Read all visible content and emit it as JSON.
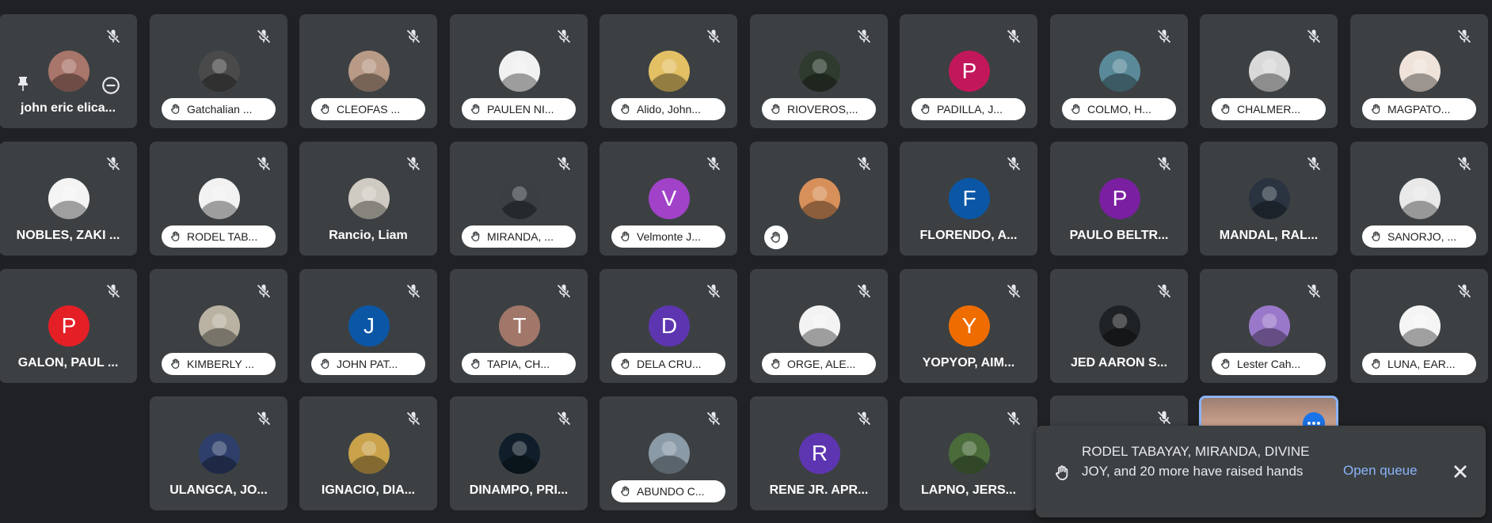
{
  "tiles": [
    {
      "name": "john eric elica...",
      "style": "plain",
      "avatar": {
        "type": "photo",
        "bg": "#a9766b"
      },
      "pin": true
    },
    {
      "name": "Gatchalian ...",
      "style": "pill",
      "avatar": {
        "type": "photo",
        "bg": "#4a4a4a"
      }
    },
    {
      "name": "CLEOFAS ...",
      "style": "pill",
      "avatar": {
        "type": "photo",
        "bg": "#b89a86"
      }
    },
    {
      "name": "PAULEN NI...",
      "style": "pill",
      "avatar": {
        "type": "photo",
        "bg": "#f1f1f1"
      }
    },
    {
      "name": "Alido, John...",
      "style": "pill",
      "avatar": {
        "type": "photo",
        "bg": "#e3c064"
      }
    },
    {
      "name": "RIOVEROS,...",
      "style": "pill",
      "avatar": {
        "type": "photo",
        "bg": "#2e3b2e"
      }
    },
    {
      "name": "PADILLA, J...",
      "style": "pill",
      "avatar": {
        "type": "letter",
        "letter": "P",
        "bg": "#c2185b"
      }
    },
    {
      "name": "COLMO, H...",
      "style": "pill",
      "avatar": {
        "type": "photo",
        "bg": "#5a8a9a"
      }
    },
    {
      "name": "CHALMER...",
      "style": "pill",
      "avatar": {
        "type": "photo",
        "bg": "#d9d9d9"
      }
    },
    {
      "name": "MAGPATO...",
      "style": "pill",
      "avatar": {
        "type": "photo",
        "bg": "#efe3da"
      }
    },
    {
      "name": "NOBLES, ZAKI ...",
      "style": "plain",
      "avatar": {
        "type": "photo",
        "bg": "#f4f4f4"
      }
    },
    {
      "name": "RODEL TAB...",
      "style": "pill",
      "avatar": {
        "type": "photo",
        "bg": "#f2f2f2"
      }
    },
    {
      "name": "Rancio, Liam",
      "style": "plain",
      "avatar": {
        "type": "photo",
        "bg": "#cfcac2"
      }
    },
    {
      "name": "MIRANDA, ...",
      "style": "pill",
      "avatar": {
        "type": "photo",
        "bg": "#3b3f42"
      }
    },
    {
      "name": "Velmonte J...",
      "style": "pill",
      "avatar": {
        "type": "letter",
        "letter": "V",
        "bg": "#a142c8"
      }
    },
    {
      "name": "",
      "style": "hand-only",
      "avatar": {
        "type": "photo",
        "bg": "#d8905a"
      }
    },
    {
      "name": "FLORENDO, A...",
      "style": "plain",
      "avatar": {
        "type": "letter",
        "letter": "F",
        "bg": "#0b57a6"
      }
    },
    {
      "name": "PAULO BELTR...",
      "style": "plain",
      "avatar": {
        "type": "letter",
        "letter": "P",
        "bg": "#7b1fa2"
      }
    },
    {
      "name": "MANDAL, RAL...",
      "style": "plain",
      "avatar": {
        "type": "photo",
        "bg": "#2a3440"
      }
    },
    {
      "name": "SANORJO, ...",
      "style": "pill",
      "avatar": {
        "type": "photo",
        "bg": "#e9e9e9"
      }
    },
    {
      "name": "GALON, PAUL ...",
      "style": "plain",
      "avatar": {
        "type": "letter",
        "letter": "P",
        "bg": "#e41f26"
      }
    },
    {
      "name": "KIMBERLY ...",
      "style": "pill",
      "avatar": {
        "type": "photo",
        "bg": "#b9b2a2"
      }
    },
    {
      "name": "JOHN PAT...",
      "style": "pill",
      "avatar": {
        "type": "letter",
        "letter": "J",
        "bg": "#0b57a6"
      }
    },
    {
      "name": "TAPIA, CH...",
      "style": "pill",
      "avatar": {
        "type": "letter",
        "letter": "T",
        "bg": "#a1776a"
      }
    },
    {
      "name": "DELA CRU...",
      "style": "pill",
      "avatar": {
        "type": "letter",
        "letter": "D",
        "bg": "#5e35b1"
      }
    },
    {
      "name": "ORGE, ALE...",
      "style": "pill",
      "avatar": {
        "type": "photo",
        "bg": "#f3f3f3"
      }
    },
    {
      "name": "YOPYOP, AIM...",
      "style": "plain",
      "avatar": {
        "type": "letter",
        "letter": "Y",
        "bg": "#ef6c00"
      }
    },
    {
      "name": "JED AARON S...",
      "style": "plain",
      "avatar": {
        "type": "photo",
        "bg": "#1f2224"
      }
    },
    {
      "name": "Lester Cah...",
      "style": "pill",
      "avatar": {
        "type": "photo",
        "bg": "#9a78c9"
      }
    },
    {
      "name": "LUNA, EAR...",
      "style": "pill",
      "avatar": {
        "type": "photo",
        "bg": "#f5f5f5"
      }
    },
    {
      "name": "ULANGCA, JO...",
      "style": "plain",
      "avatar": {
        "type": "photo",
        "bg": "#2d3f6a"
      }
    },
    {
      "name": "IGNACIO, DIA...",
      "style": "plain",
      "avatar": {
        "type": "photo",
        "bg": "#c9a24a"
      }
    },
    {
      "name": "DINAMPO, PRI...",
      "style": "plain",
      "avatar": {
        "type": "photo",
        "bg": "#0f1e2a"
      }
    },
    {
      "name": "ABUNDO C...",
      "style": "pill",
      "avatar": {
        "type": "photo",
        "bg": "#8a9aa6"
      }
    },
    {
      "name": "RENE JR. APR...",
      "style": "plain",
      "avatar": {
        "type": "letter",
        "letter": "R",
        "bg": "#5e35b1"
      }
    },
    {
      "name": "LAPNO, JERS...",
      "style": "plain",
      "avatar": {
        "type": "photo",
        "bg": "#4a6b3a"
      }
    }
  ],
  "toast": {
    "message": "RODEL TABAYAY, MIRANDA, DIVINE JOY, and 20 more have raised hands",
    "action": "Open queue",
    "close_icon": "close-icon",
    "hand_icon": "raised-hand-icon"
  },
  "colors": {
    "background": "#202124",
    "tile": "#3c4043",
    "accent": "#8ab4f8",
    "more": "#1a73e8"
  },
  "icons": {
    "mic_off": "mic-off-icon",
    "hand": "raised-hand-icon",
    "pin": "pin-icon",
    "remove": "remove-icon",
    "more": "more-options-icon"
  }
}
